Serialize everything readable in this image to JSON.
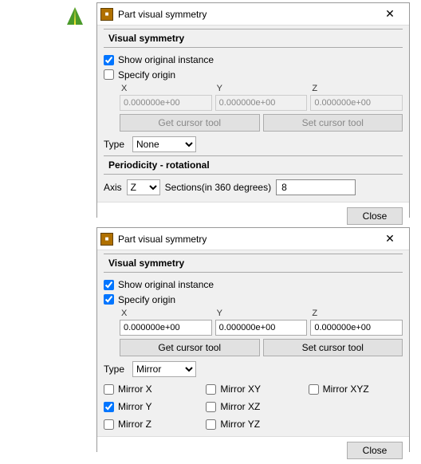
{
  "app_icon_name": "road-app-icon",
  "dialog1": {
    "title": "Part visual symmetry",
    "section_visual": "Visual symmetry",
    "show_original": "Show original instance",
    "show_original_checked": true,
    "specify_origin": "Specify origin",
    "specify_origin_checked": false,
    "x_label": "X",
    "y_label": "Y",
    "z_label": "Z",
    "x_val": "0.000000e+00",
    "y_val": "0.000000e+00",
    "z_val": "0.000000e+00",
    "get_cursor": "Get cursor tool",
    "set_cursor": "Set cursor tool",
    "type_label": "Type",
    "type_value": "None",
    "section_periodicity": "Periodicity - rotational",
    "axis_label": "Axis",
    "axis_value": "Z",
    "sections_label": "Sections(in 360 degrees)",
    "sections_value": "8",
    "close": "Close"
  },
  "dialog2": {
    "title": "Part visual symmetry",
    "section_visual": "Visual symmetry",
    "show_original": "Show original instance",
    "show_original_checked": true,
    "specify_origin": "Specify origin",
    "specify_origin_checked": true,
    "x_label": "X",
    "y_label": "Y",
    "z_label": "Z",
    "x_val": "0.000000e+00",
    "y_val": "0.000000e+00",
    "z_val": "0.000000e+00",
    "get_cursor": "Get cursor tool",
    "set_cursor": "Set cursor tool",
    "type_label": "Type",
    "type_value": "Mirror",
    "mirror": {
      "x": {
        "label": "Mirror X",
        "checked": false
      },
      "xy": {
        "label": "Mirror XY",
        "checked": false
      },
      "xyz": {
        "label": "Mirror XYZ",
        "checked": false
      },
      "y": {
        "label": "Mirror Y",
        "checked": true
      },
      "xz": {
        "label": "Mirror XZ",
        "checked": false
      },
      "z": {
        "label": "Mirror Z",
        "checked": false
      },
      "yz": {
        "label": "Mirror YZ",
        "checked": false
      }
    },
    "close": "Close"
  }
}
